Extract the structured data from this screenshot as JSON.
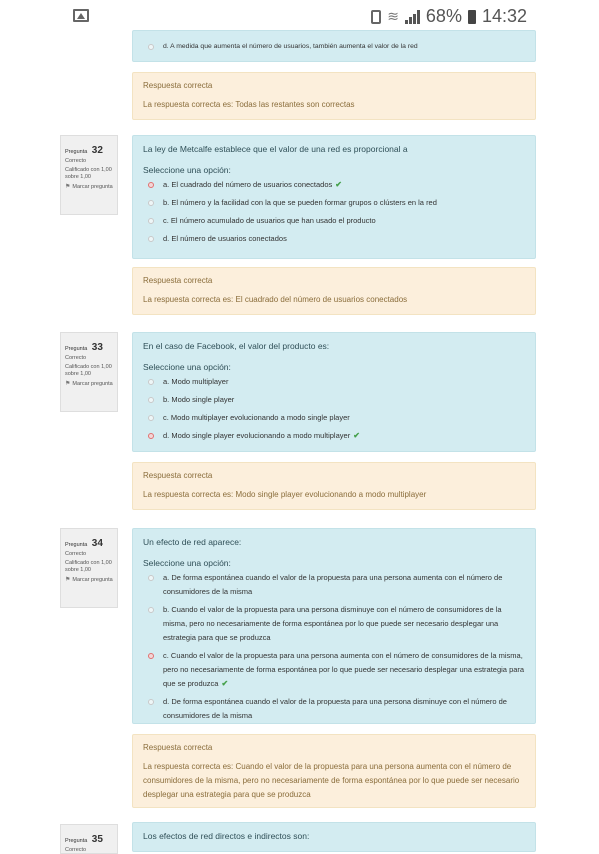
{
  "status_bar": {
    "battery_percent": "68%",
    "time": "14:32",
    "icons": [
      "picture-icon",
      "sim-icon",
      "wifi-icon",
      "signal-icon",
      "battery-icon"
    ]
  },
  "prev_question": {
    "option_d": "d. A medida que aumenta el número de usuarios, también aumenta el valor de la red",
    "feedback_title": "Respuesta correcta",
    "feedback_text": "La respuesta correcta es: Todas las restantes son correctas"
  },
  "questions": [
    {
      "label": "Pregunta",
      "number": "32",
      "state": "Correcto",
      "grade": "Calificado con 1,00 sobre 1,00",
      "flag": "Marcar pregunta",
      "text": "La ley de Metcalfe establece que el valor de una red es proporcional a",
      "prompt": "Seleccione una opción:",
      "options": [
        "a. El cuadrado del número de usuarios conectados",
        "b. El número y la facilidad con la que se pueden formar grupos o clústers en la red",
        "c. El número acumulado de usuarios que han usado el producto",
        "d. El número de usuarios conectados"
      ],
      "selected": 0,
      "feedback_title": "Respuesta correcta",
      "feedback_text": "La respuesta correcta es: El cuadrado del número de usuarios conectados"
    },
    {
      "label": "Pregunta",
      "number": "33",
      "state": "Correcto",
      "grade": "Calificado con 1,00 sobre 1,00",
      "flag": "Marcar pregunta",
      "text": "En el caso de Facebook, el valor del producto es:",
      "prompt": "Seleccione una opción:",
      "options": [
        "a. Modo multiplayer",
        "b. Modo single player",
        "c. Modo multiplayer evolucionando a modo single player",
        "d. Modo single player evolucionando a modo multiplayer"
      ],
      "selected": 3,
      "feedback_title": "Respuesta correcta",
      "feedback_text": "La respuesta correcta es: Modo single player evolucionando a modo multiplayer"
    },
    {
      "label": "Pregunta",
      "number": "34",
      "state": "Correcto",
      "grade": "Calificado con 1,00 sobre 1,00",
      "flag": "Marcar pregunta",
      "text": "Un efecto de red aparece:",
      "prompt": "Seleccione una opción:",
      "options": [
        "a. De forma espontánea cuando el valor de la propuesta para una persona aumenta con el número de consumidores de la misma",
        "b. Cuando el valor de la propuesta para una persona disminuye con el número de consumidores de la misma, pero no necesariamente de forma espontánea por lo que puede ser necesario desplegar una estrategia para que se produzca",
        "c. Cuando el valor de la propuesta para una persona aumenta con el número de consumidores de la misma, pero no necesariamente de forma espontánea por lo que puede ser necesario desplegar una estrategia para que se produzca",
        "d. De forma espontánea cuando el valor de la propuesta para una persona disminuye con el número de consumidores de la misma"
      ],
      "selected": 2,
      "feedback_title": "Respuesta correcta",
      "feedback_text": "La respuesta correcta es: Cuando el valor de la propuesta para una persona aumenta con el número de consumidores de la misma, pero no necesariamente de forma espontánea por lo que puede ser necesario desplegar una estrategia para que se produzca"
    },
    {
      "label": "Pregunta",
      "number": "35",
      "state": "Correcto",
      "text": "Los efectos de red directos e indirectos son:"
    }
  ],
  "colors": {
    "question_bg": "#d3ecf1",
    "feedback_bg": "#fcefdc",
    "correct_check": "#44a04a"
  }
}
